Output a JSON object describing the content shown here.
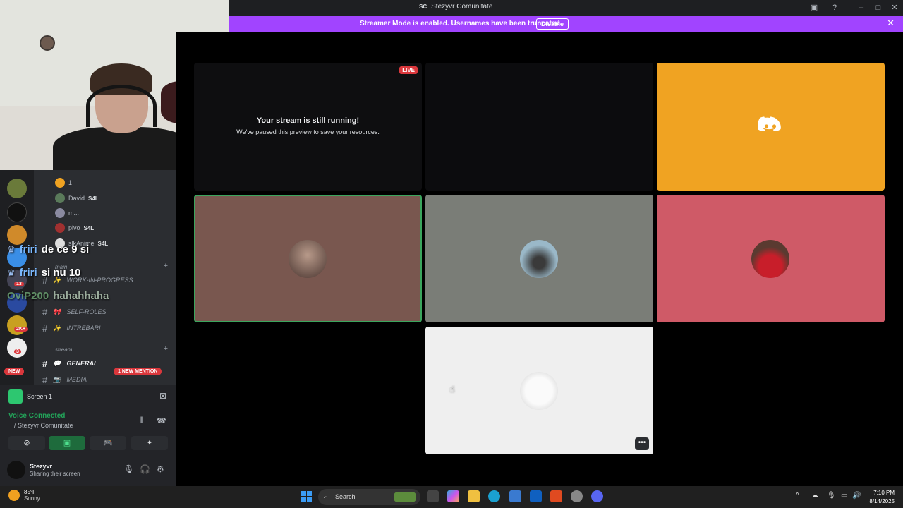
{
  "window": {
    "title": "Stezyvr Comunitate",
    "logo": "SC"
  },
  "banner": {
    "message": "Streamer Mode is enabled. Usernames have been truncated.",
    "button": "Disable"
  },
  "members": [
    {
      "name": "1",
      "tag": ""
    },
    {
      "name": "David",
      "tag": "S4L"
    },
    {
      "name": "m...",
      "tag": ""
    },
    {
      "name": "pivo",
      "tag": "S4L"
    },
    {
      "name": "slkAnime",
      "tag": "S4L"
    }
  ],
  "categories": {
    "main": "main ⠀",
    "stream": "stream ⠀"
  },
  "channels": [
    {
      "name": "WORK-IN-PROGRESS",
      "icon": "✨"
    },
    {
      "name": "SELF-ROLES",
      "icon": "🎀"
    },
    {
      "name": "INTREBARI",
      "icon": "✨"
    },
    {
      "name": "GENERAL",
      "icon": "💬"
    },
    {
      "name": "MEDIA",
      "icon": "📷"
    }
  ],
  "badges": {
    "new": "NEW",
    "mention": "1 NEW MENTION"
  },
  "guild_badges": [
    "13",
    "2K+",
    "3"
  ],
  "chat_overlay": [
    {
      "user": "friri",
      "text": "de ce 9 si"
    },
    {
      "user": "friri",
      "text": "si nu 10"
    },
    {
      "user": "OviP200",
      "text": "hahahhaha"
    }
  ],
  "screen": {
    "label": "Screen 1"
  },
  "voice": {
    "status": "Voice Connected",
    "server": "/ Stezyvr Comunitate"
  },
  "user": {
    "name": "Stezyvr",
    "status": "Sharing their screen"
  },
  "stream_tile": {
    "live": "LIVE",
    "title": "Your stream is still running!",
    "subtitle": "We've paused this preview to save your resources."
  },
  "tile_colors": {
    "discord": "#f0a322",
    "brown": "#79574f",
    "gray": "#7a7d77",
    "rose": "#cf5a67",
    "white": "#efefef"
  },
  "accent": {
    "banner": "#a144ff",
    "green": "#23a55a",
    "red": "#da373c"
  },
  "taskbar": {
    "weather_temp": "85°F",
    "weather_desc": "Sunny",
    "search_label": "Search",
    "time": "7:10 PM",
    "date": "8/14/2025"
  }
}
